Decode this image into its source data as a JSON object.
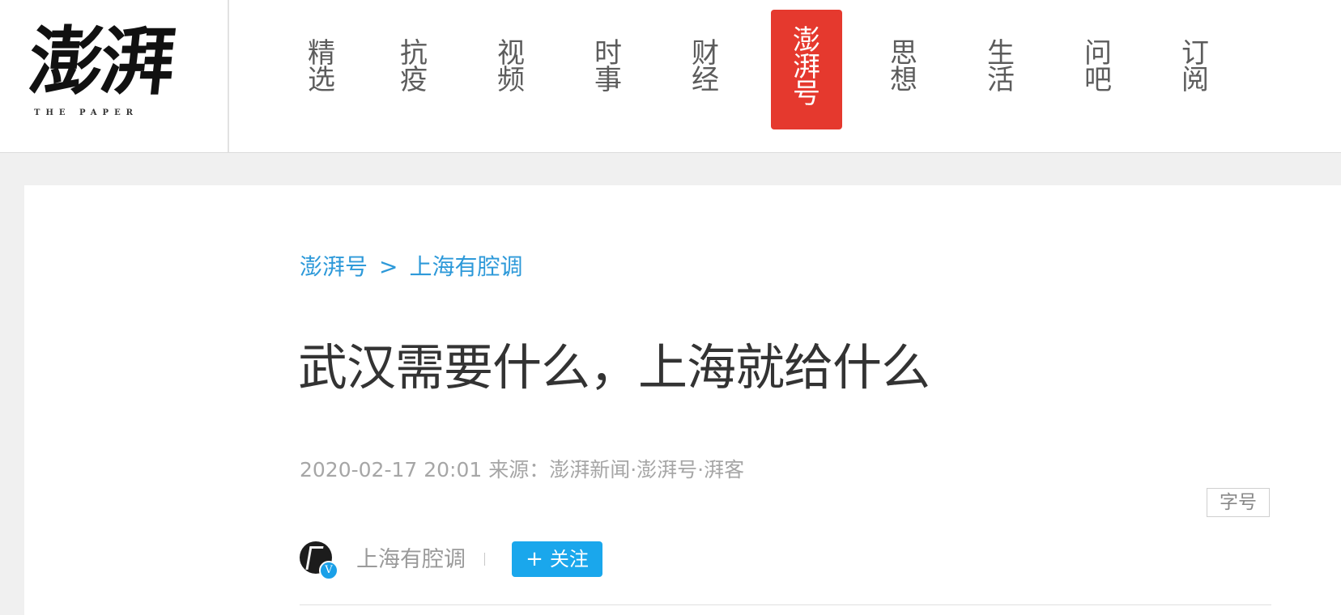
{
  "site": {
    "logo_text": "澎湃",
    "logo_sub": "THE PAPER"
  },
  "nav": [
    {
      "line1": "精",
      "line2": "选"
    },
    {
      "line1": "抗",
      "line2": "疫"
    },
    {
      "line1": "视",
      "line2": "频"
    },
    {
      "line1": "时",
      "line2": "事"
    },
    {
      "line1": "财",
      "line2": "经"
    },
    {
      "line1": "澎",
      "line2": "湃",
      "line3": "号",
      "active": true
    },
    {
      "line1": "思",
      "line2": "想"
    },
    {
      "line1": "生",
      "line2": "活"
    },
    {
      "line1": "问",
      "line2": "吧"
    },
    {
      "line1": "订",
      "line2": "阅"
    }
  ],
  "breadcrumb": {
    "section": "澎湃号",
    "separator": ">",
    "channel": "上海有腔调"
  },
  "article": {
    "title": "武汉需要什么，上海就给什么",
    "meta": "2020-02-17 20:01 来源：澎湃新闻·澎湃号·湃客",
    "font_size_label": "字号"
  },
  "author": {
    "name": "上海有腔调",
    "verified_mark": "V",
    "follow_plus": "+",
    "follow_label": "关注"
  },
  "colors": {
    "accent_red": "#e5392e",
    "link_blue": "#2d99d9",
    "follow_blue": "#1aa7ec"
  }
}
